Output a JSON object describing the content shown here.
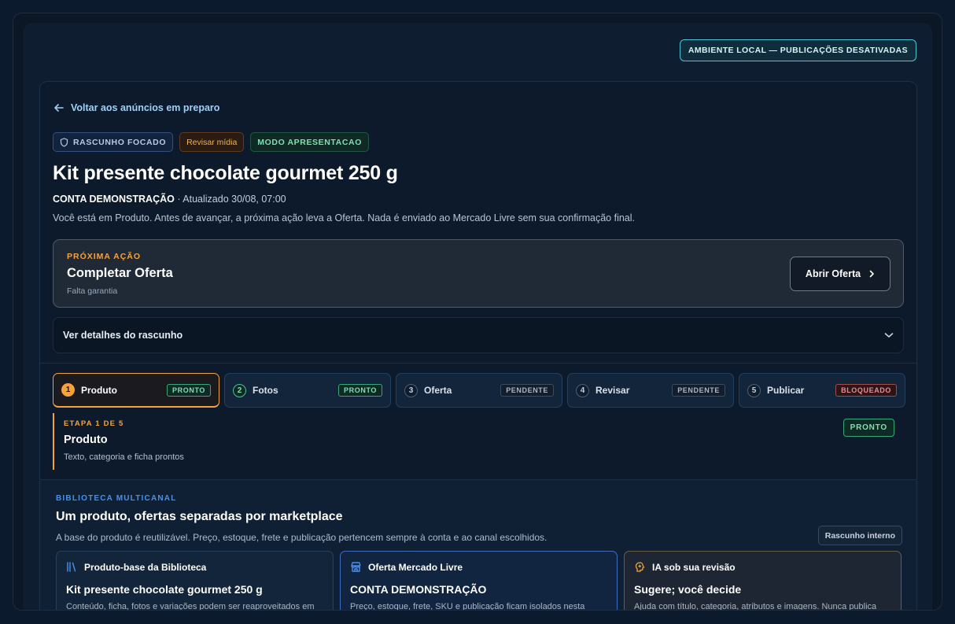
{
  "env_badge": "AMBIENTE LOCAL — PUBLICAÇÕES DESATIVADAS",
  "back_link": "Voltar aos anúncios em preparo",
  "chips": {
    "draft": "RASCUNHO FOCADO",
    "review": "Revisar mídia",
    "mode": "MODO APRESENTACAO"
  },
  "product": {
    "title": "Kit presente chocolate gourmet 250 g",
    "account": "CONTA DEMONSTRAÇÃO",
    "updated": " · Atualizado 30/08, 07:00",
    "note": "Você está em Produto. Antes de avançar, a próxima ação leva a Oferta. Nada é enviado ao Mercado Livre sem sua confirmação final."
  },
  "next_action": {
    "label": "PRÓXIMA AÇÃO",
    "title": "Completar Oferta",
    "subtitle": "Falta garantia",
    "button": "Abrir Oferta"
  },
  "details_toggle": "Ver detalhes do rascunho",
  "steps": [
    {
      "num": "1",
      "label": "Produto",
      "status": "PRONTO"
    },
    {
      "num": "2",
      "label": "Fotos",
      "status": "PRONTO"
    },
    {
      "num": "3",
      "label": "Oferta",
      "status": "PENDENTE"
    },
    {
      "num": "4",
      "label": "Revisar",
      "status": "PENDENTE"
    },
    {
      "num": "5",
      "label": "Publicar",
      "status": "BLOQUEADO"
    }
  ],
  "stage": {
    "label": "ETAPA 1 DE 5",
    "title": "Produto",
    "subtitle": "Texto, categoria e ficha prontos",
    "badge": "PRONTO"
  },
  "library": {
    "label": "BIBLIOTECA MULTICANAL",
    "title": "Um produto, ofertas separadas por marketplace",
    "subtitle": "A base do produto é reutilizável. Preço, estoque, frete e publicação pertencem sempre à conta e ao canal escolhidos.",
    "button": "Rascunho interno",
    "cards": [
      {
        "icon": "library-icon",
        "head": "Produto-base da Biblioteca",
        "title": "Kit presente chocolate gourmet 250 g",
        "text": "Conteúdo, ficha, fotos e variações podem ser reaproveitados em"
      },
      {
        "icon": "store-icon",
        "head": "Oferta Mercado Livre",
        "title": "CONTA DEMONSTRAÇÃO",
        "text": "Preço, estoque, frete, SKU e publicação ficam isolados nesta"
      },
      {
        "icon": "ai-brain-icon",
        "head": "IA sob sua revisão",
        "title": "Sugere; você decide",
        "text": "Ajuda com título, categoria, atributos e imagens. Nunca publica"
      }
    ]
  },
  "colors": {
    "accent_orange": "#f5a23d",
    "ready_green": "#7ee0b0",
    "blocked_red": "#f08a8f",
    "library_blue": "#4a90e8"
  }
}
